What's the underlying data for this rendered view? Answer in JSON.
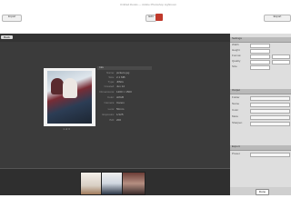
{
  "window": {
    "title": "Untitled.ibooks — Adobe Photoshop Lightroom"
  },
  "toolbar": {
    "left_button": "Import",
    "middle_button": "Edit",
    "right_button": "Export"
  },
  "main": {
    "back_label": "Back",
    "info": {
      "header": "Info",
      "rows": [
        {
          "label": "Name:",
          "value": "pickers.jpg"
        },
        {
          "label": "Size:",
          "value": "2.1 MB"
        },
        {
          "label": "Type:",
          "value": "JPEG"
        },
        {
          "label": "Created:",
          "value": "Jun 12"
        },
        {
          "label": "Dimensions:",
          "value": "1200 × 1500"
        },
        {
          "label": "Color:",
          "value": "sRGB"
        },
        {
          "label": "Camera:",
          "value": "Canon"
        },
        {
          "label": "Lens:",
          "value": "50mm"
        },
        {
          "label": "Exposure:",
          "value": "1/125"
        },
        {
          "label": "ISO:",
          "value": "200"
        }
      ]
    },
    "caption": "1 of 3"
  },
  "sidebar": {
    "sections": [
      {
        "title": "Settings"
      },
      {
        "title": "Output"
      },
      {
        "title": "Export"
      }
    ],
    "rows": [
      {
        "label": "Width"
      },
      {
        "label": "Height"
      },
      {
        "label": "Format"
      },
      {
        "label": "Quality"
      },
      {
        "label": "Size"
      }
    ],
    "output_rows": [
      {
        "label": "Folder"
      },
      {
        "label": "Name"
      },
      {
        "label": "Color"
      },
      {
        "label": "Meta"
      },
      {
        "label": "Sharpen"
      }
    ],
    "export_rows": [
      {
        "label": "Preset"
      }
    ],
    "button_label": "Done"
  },
  "colors": {
    "main_bg": "#3b3b3b",
    "sidebar_bg": "#dedede",
    "accent": "#c0392b"
  }
}
